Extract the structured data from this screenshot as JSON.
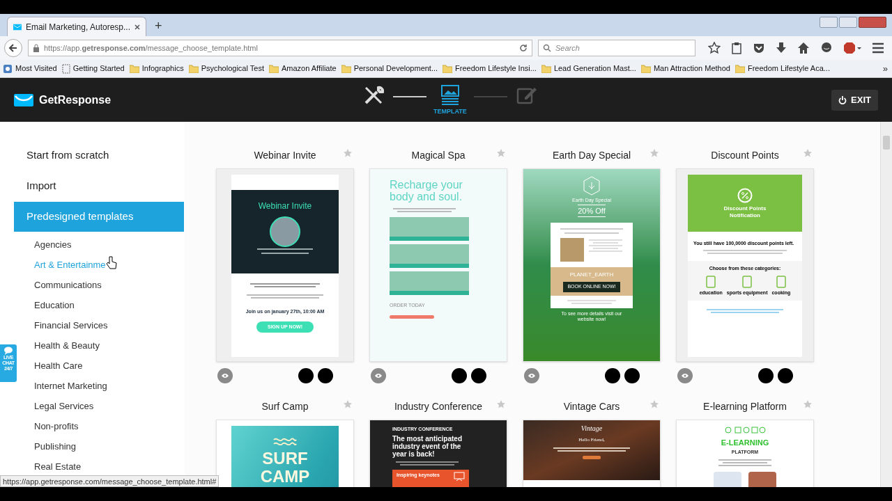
{
  "browser": {
    "tabs": [
      {
        "title": "Email Marketing, Autoresp...",
        "selected": true
      }
    ],
    "new_tab": "+",
    "address": "https://app.**getresponse.com**/message_choose_template.html",
    "search": {
      "placeholder": "Search"
    },
    "bookmarks": [
      {
        "kind": "star",
        "label": "Most Visited"
      },
      {
        "kind": "page",
        "label": "Getting Started"
      },
      {
        "kind": "folder",
        "label": "Infographics"
      },
      {
        "kind": "folder",
        "label": "Psychological Test"
      },
      {
        "kind": "folder",
        "label": "Amazon Affiliate"
      },
      {
        "kind": "folder",
        "label": "Personal Development..."
      },
      {
        "kind": "folder",
        "label": "Freedom Lifestyle Insi..."
      },
      {
        "kind": "folder",
        "label": "Lead Generation Mast..."
      },
      {
        "kind": "folder",
        "label": "Man Attraction Method"
      },
      {
        "kind": "folder",
        "label": "Freedom Lifestyle Aca..."
      }
    ],
    "more": "»"
  },
  "app": {
    "logo": "GetResponse",
    "steps": [
      {
        "kind": "tools",
        "completed": true,
        "selected": false
      },
      {
        "kind": "template",
        "label": "TEMPLATE",
        "completed": false,
        "selected": true
      },
      {
        "kind": "edit",
        "completed": false,
        "selected": false
      }
    ],
    "exit": "EXIT"
  },
  "sidebar": {
    "options": [
      {
        "label": "Start from scratch",
        "selected": false
      },
      {
        "label": "Import",
        "selected": false
      },
      {
        "label": "Predesigned templates",
        "selected": true
      }
    ],
    "categories": [
      {
        "label": "Agencies",
        "hovered": false
      },
      {
        "label": "Art & Entertainme",
        "hovered": true
      },
      {
        "label": "Communications",
        "hovered": false
      },
      {
        "label": "Education",
        "hovered": false
      },
      {
        "label": "Financial Services",
        "hovered": false
      },
      {
        "label": "Health & Beauty",
        "hovered": false
      },
      {
        "label": "Health Care",
        "hovered": false
      },
      {
        "label": "Internet Marketing",
        "hovered": false
      },
      {
        "label": "Legal Services",
        "hovered": false
      },
      {
        "label": "Non-profits",
        "hovered": false
      },
      {
        "label": "Publishing",
        "hovered": false
      },
      {
        "label": "Real Estate",
        "hovered": false
      }
    ]
  },
  "live_chat": "LIVE CHAT 24/7",
  "templates": [
    {
      "title": "Webinar Invite",
      "starred": false,
      "swatches": [
        {
          "color": "#000000"
        },
        {
          "color": "#000000"
        }
      ],
      "kind": "webinar",
      "heading": "Webinar Invite",
      "date": "Join us on january 27th, 10:00 AM",
      "button": "SIGN UP NOW!"
    },
    {
      "title": "Magical Spa",
      "starred": false,
      "swatches": [
        {
          "color": "#000000"
        },
        {
          "color": "#000000"
        }
      ],
      "kind": "spa",
      "heading": "Recharge your body and soul.",
      "label": "ORDER TODAY"
    },
    {
      "title": "Earth Day Special",
      "starred": false,
      "swatches": [
        {
          "color": "#000000"
        },
        {
          "color": "#000000"
        }
      ],
      "kind": "earth",
      "label": "Earth Day Special",
      "offer": "20% Off",
      "code": "PLANET_EARTH",
      "button": "BOOK ONLINE NOW!",
      "footer": "To see more details visit our website now!"
    },
    {
      "title": "Discount Points",
      "starred": false,
      "swatches": [
        {
          "color": "#000000"
        },
        {
          "color": "#000000"
        }
      ],
      "kind": "discount",
      "heading": "Discount Points Notification",
      "points": "You still have **100,0000 discount points** left.",
      "heading2": "Choose from these categories:",
      "categories": [
        "education",
        "sports equipment",
        "cooking"
      ]
    },
    {
      "title": "Surf Camp",
      "starred": false,
      "kind": "surf",
      "heading": "SURF CAMP"
    },
    {
      "title": "Industry Conference",
      "starred": false,
      "kind": "conference",
      "label": "INDUSTRY CONFERENCE",
      "heading": "The most anticipated industry event of the year is back!",
      "bar": "Inspiring keynotes"
    },
    {
      "title": "Vintage Cars",
      "starred": false,
      "kind": "vintage",
      "logo": "Vintage",
      "greeting": "Hello Friend,"
    },
    {
      "title": "E-learning Platform",
      "starred": false,
      "kind": "elearning",
      "heading": "E-LEARNING",
      "sub": "PLATFORM"
    }
  ],
  "status_url": "https://app.getresponse.com/message_choose_template.html#"
}
